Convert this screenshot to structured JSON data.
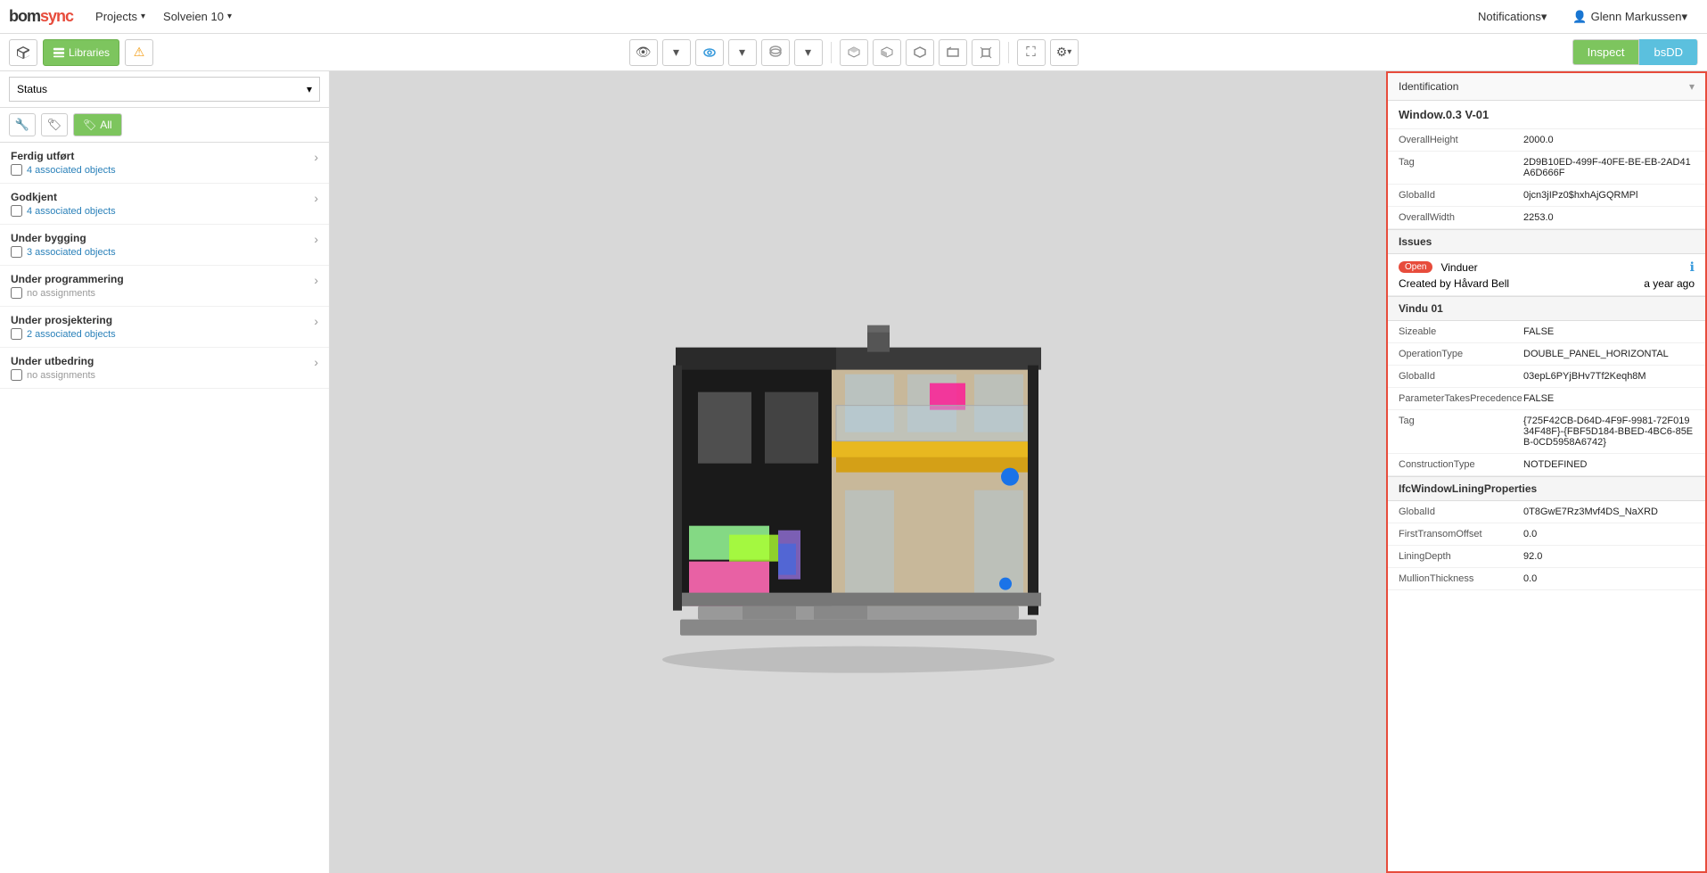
{
  "app": {
    "logo": "bomsync",
    "nav_items": [
      {
        "label": "Projects",
        "has_caret": true
      },
      {
        "label": "Solveien 10",
        "has_caret": true
      }
    ]
  },
  "nav_right": {
    "notifications_label": "Notifications",
    "user_label": "Glenn Markussen"
  },
  "toolbar": {
    "icons": [
      "cube",
      "libraries",
      "warning"
    ],
    "libraries_label": "Libraries",
    "view_buttons": [
      "eye",
      "eye-outline",
      "layers"
    ],
    "shape_buttons": [
      "box1",
      "box2",
      "box3",
      "box4",
      "box5"
    ],
    "expand_icon": "⛶",
    "settings_icon": "⚙"
  },
  "inspect_tab": "Inspect",
  "bsdd_tab": "bsDD",
  "left_panel": {
    "status_label": "Status",
    "filter_all": "All",
    "items": [
      {
        "title": "Ferdig utført",
        "has_checkbox": true,
        "sub_label": "4 associated objects",
        "has_link": true
      },
      {
        "title": "Godkjent",
        "has_checkbox": true,
        "sub_label": "4 associated objects",
        "has_link": true
      },
      {
        "title": "Under bygging",
        "has_checkbox": true,
        "sub_label": "3 associated objects",
        "has_link": true
      },
      {
        "title": "Under programmering",
        "has_checkbox": true,
        "sub_label": "no assignments",
        "has_link": false
      },
      {
        "title": "Under prosjektering",
        "has_checkbox": true,
        "sub_label": "2 associated objects",
        "has_link": true
      },
      {
        "title": "Under utbedring",
        "has_checkbox": true,
        "sub_label": "no assignments",
        "has_link": false
      }
    ]
  },
  "right_panel": {
    "identification_label": "Identification",
    "object_name": "Window.0.3 V-01",
    "properties": [
      {
        "label": "OverallHeight",
        "value": "2000.0"
      },
      {
        "label": "Tag",
        "value": "2D9B10ED-499F-40FE-BE-EB-2AD41A6D666F"
      },
      {
        "label": "GlobalId",
        "value": "0jcn3jIPz0$hxhAjGQRMPl"
      },
      {
        "label": "OverallWidth",
        "value": "2253.0"
      }
    ],
    "issues_section_label": "Issues",
    "issue": {
      "status": "Open",
      "title": "Vinduer",
      "created_by": "Created by Håvard Bell",
      "time_ago": "a year ago"
    },
    "vindu_section": "Vindu 01",
    "vindu_properties": [
      {
        "label": "Sizeable",
        "value": "FALSE"
      },
      {
        "label": "OperationType",
        "value": "DOUBLE_PANEL_HORIZONTAL"
      },
      {
        "label": "GlobalId",
        "value": "03epL6PYjBHv7Tf2Keqh8M"
      },
      {
        "label": "ParameterTakesPrecedence",
        "value": "FALSE"
      },
      {
        "label": "Tag",
        "value": "{725F42CB-D64D-4F9F-9981-72F01934F48F}-{FBF5D184-BBED-4BC6-85EB-0CD5958A6742}"
      },
      {
        "label": "ConstructionType",
        "value": "NOTDEFINED"
      }
    ],
    "ifc_section": "IfcWindowLiningProperties",
    "ifc_properties": [
      {
        "label": "GlobalId",
        "value": "0T8GwE7Rz3Mvf4DS_NaXRD"
      },
      {
        "label": "FirstTransomOffset",
        "value": "0.0"
      },
      {
        "label": "LiningDepth",
        "value": "92.0"
      },
      {
        "label": "MullionThickness",
        "value": "0.0"
      }
    ]
  }
}
